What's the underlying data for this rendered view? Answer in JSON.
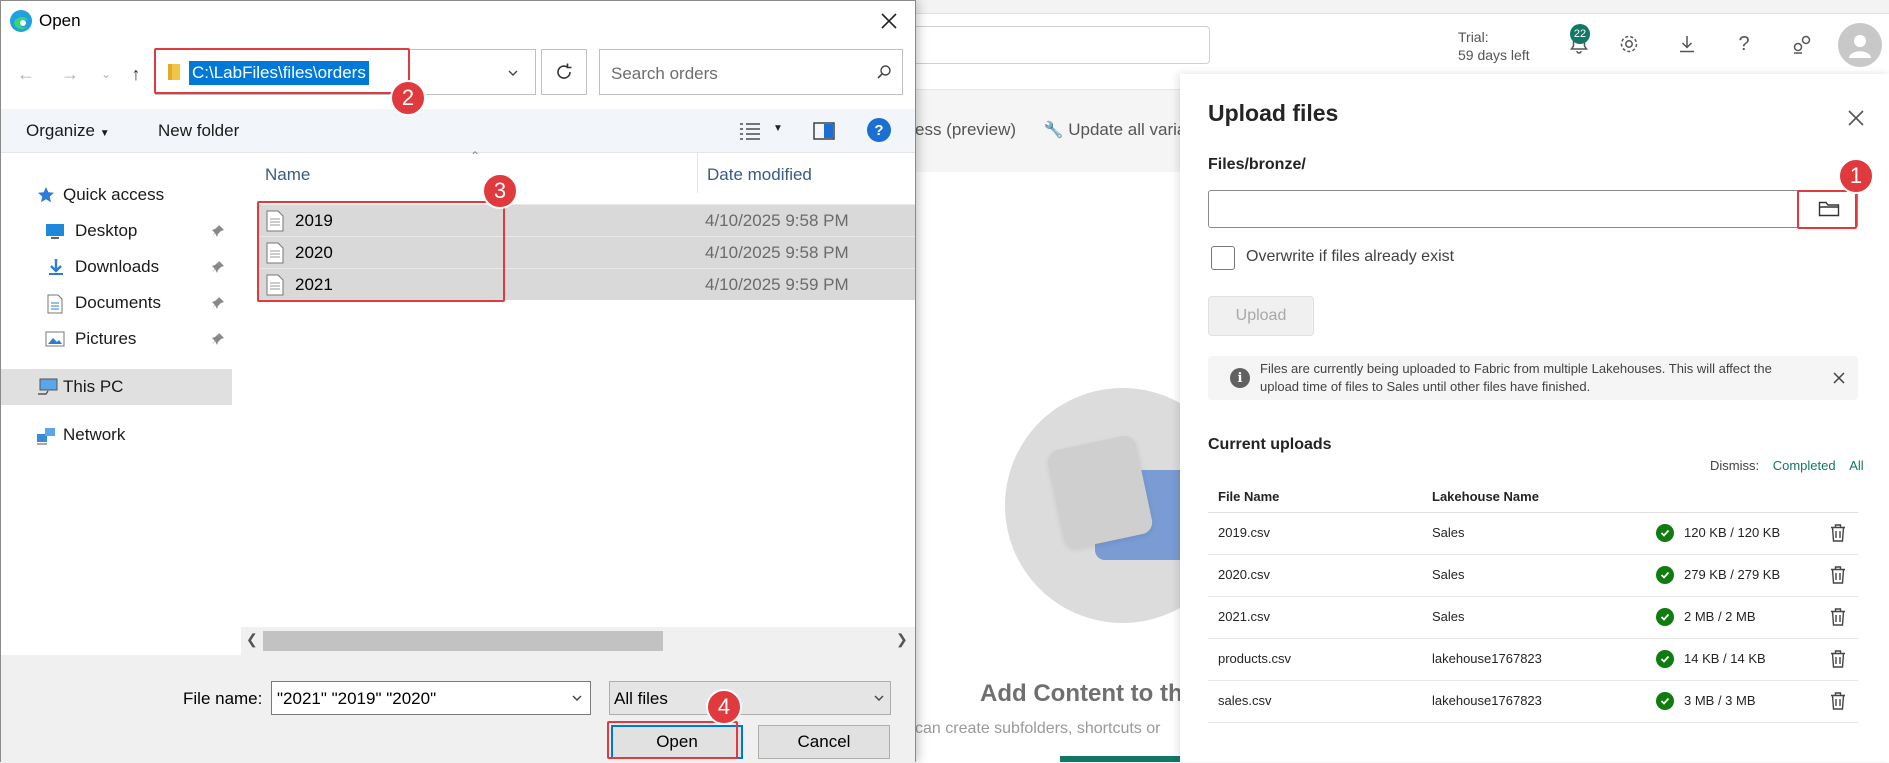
{
  "webapp": {
    "trial_line1": "Trial:",
    "trial_line2": "59 days left",
    "notification_count": "22",
    "ribbon": {
      "item1": "ess (preview)",
      "item2": "Update all varial"
    },
    "add_content_title": "Add Content to th",
    "add_content_sub": "can create subfolders, shortcuts or"
  },
  "upload_panel": {
    "title": "Upload files",
    "path": "Files/bronze/",
    "overwrite_label": "Overwrite if files already exist",
    "upload_button": "Upload",
    "info_message": "Files are currently being uploaded to Fabric from multiple Lakehouses. This will affect the upload time of files to Sales until other files have finished.",
    "current_uploads_title": "Current uploads",
    "dismiss_label": "Dismiss:",
    "dismiss_completed": "Completed",
    "dismiss_all": "All",
    "columns": [
      "File Name",
      "Lakehouse Name"
    ],
    "rows": [
      {
        "file": "2019.csv",
        "lakehouse": "Sales",
        "progress": "120 KB / 120 KB"
      },
      {
        "file": "2020.csv",
        "lakehouse": "Sales",
        "progress": "279 KB / 279 KB"
      },
      {
        "file": "2021.csv",
        "lakehouse": "Sales",
        "progress": "2 MB / 2 MB"
      },
      {
        "file": "products.csv",
        "lakehouse": "lakehouse1767823",
        "progress": "14 KB / 14 KB"
      },
      {
        "file": "sales.csv",
        "lakehouse": "lakehouse1767823",
        "progress": "3 MB / 3 MB"
      }
    ]
  },
  "dialog": {
    "title": "Open",
    "address": "C:\\LabFiles\\files\\orders",
    "search_placeholder": "Search orders",
    "organize": "Organize",
    "new_folder": "New folder",
    "sidebar": {
      "quick_access": "Quick access",
      "desktop": "Desktop",
      "downloads": "Downloads",
      "documents": "Documents",
      "pictures": "Pictures",
      "this_pc": "This PC",
      "network": "Network"
    },
    "columns": {
      "name": "Name",
      "date_modified": "Date modified"
    },
    "files": [
      {
        "name": "2019",
        "date": "4/10/2025 9:58 PM"
      },
      {
        "name": "2020",
        "date": "4/10/2025 9:58 PM"
      },
      {
        "name": "2021",
        "date": "4/10/2025 9:59 PM"
      }
    ],
    "file_name_label": "File name:",
    "file_name_value": "\"2021\" \"2019\" \"2020\"",
    "file_type": "All files",
    "open_button": "Open",
    "cancel_button": "Cancel"
  },
  "annotations": {
    "step1": "1",
    "step2": "2",
    "step3": "3",
    "step4": "4",
    "color": "#e0393e"
  },
  "colors": {
    "accent_green": "#117865",
    "selection_blue": "#0078d7",
    "success_green": "#107c10"
  },
  "icons": [
    "edge-icon",
    "close-icon",
    "back-arrow-icon",
    "forward-arrow-icon",
    "up-arrow-icon",
    "folder-icon",
    "refresh-icon",
    "search-icon",
    "view-icon",
    "help-icon",
    "star-icon",
    "desktop-icon",
    "download-icon",
    "document-icon",
    "pictures-icon",
    "pc-icon",
    "network-icon",
    "pin-icon",
    "file-icon",
    "bell-icon",
    "gear-icon",
    "download-tray-icon",
    "question-icon",
    "share-icon",
    "avatar-icon",
    "info-icon",
    "check-icon",
    "trash-icon",
    "browse-folder-icon"
  ]
}
